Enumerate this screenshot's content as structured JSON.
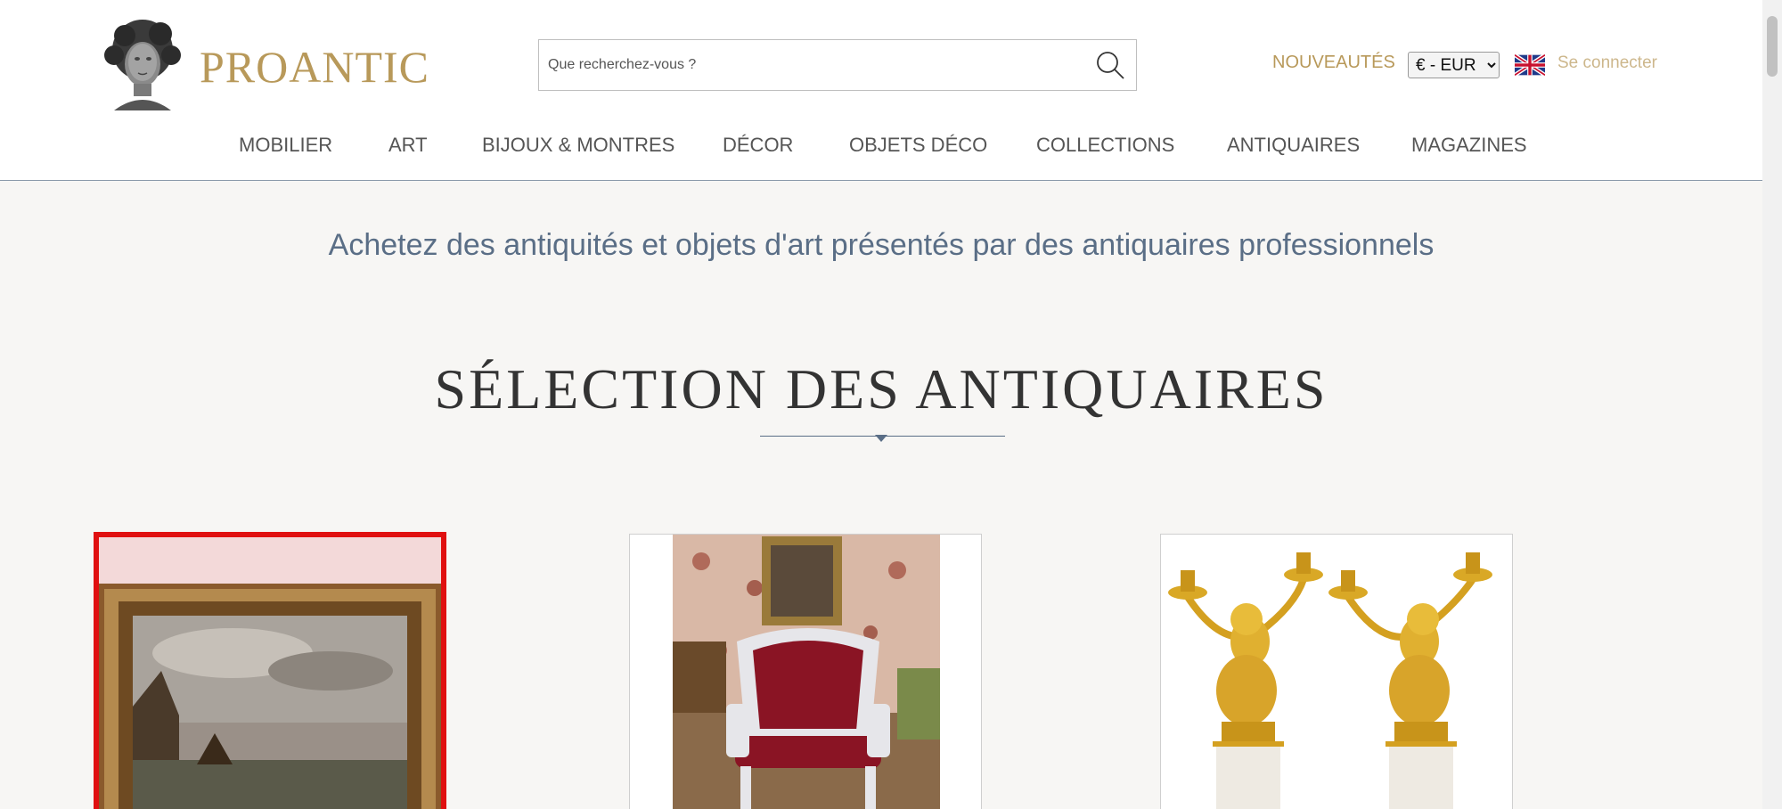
{
  "brand": {
    "name": "PROANTIC"
  },
  "search": {
    "placeholder": "Que recherchez-vous ?"
  },
  "header": {
    "new_label": "NOUVEAUTÉS",
    "currency": {
      "selected": "€ - EUR",
      "options": [
        "€ - EUR"
      ]
    },
    "language_flag": "uk-flag-icon",
    "login_label": "Se connecter"
  },
  "nav": {
    "items": [
      {
        "label": "MOBILIER"
      },
      {
        "label": "ART"
      },
      {
        "label": "BIJOUX & MONTRES"
      },
      {
        "label": "DÉCOR"
      },
      {
        "label": "OBJETS DÉCO"
      },
      {
        "label": "COLLECTIONS"
      },
      {
        "label": "ANTIQUAIRES"
      },
      {
        "label": "MAGAZINES"
      }
    ]
  },
  "tagline": "Achetez des antiquités et objets d'art présentés par des antiquaires professionnels",
  "section": {
    "title": "SÉLECTION DES ANTIQUAIRES"
  },
  "cards": [
    {
      "subject": "painting-gilded-frame-seascape",
      "selected": true
    },
    {
      "subject": "louis-xv-armchair-red-velvet",
      "selected": false
    },
    {
      "subject": "gilt-bronze-cherub-candelabra-pair",
      "selected": false
    }
  ],
  "colors": {
    "brand_gold": "#b8995a",
    "tagline_blue": "#5a6e86",
    "page_bg": "#f7f6f4",
    "selection_red": "#e01010"
  }
}
